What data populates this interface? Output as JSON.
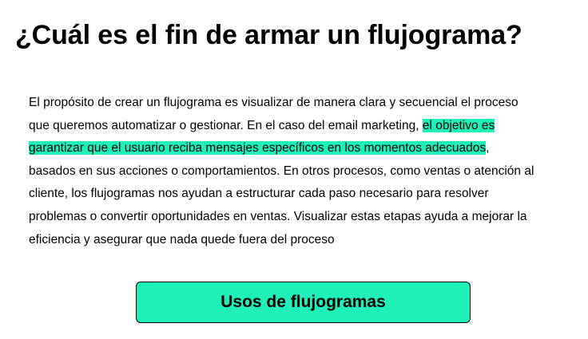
{
  "heading": "¿Cuál es el fin de armar un flujograma?",
  "paragraph": {
    "line1": "El propósito de crear un flujograma es visualizar de manera clara y secuencial el proceso",
    "line2_plain": "que queremos automatizar o gestionar. En el caso del email marketing, ",
    "line2_highlight": "el objetivo es",
    "line3_highlight": "garantizar que el usuario reciba mensajes específicos en los momentos adecuados",
    "line3_plain": ",",
    "line4": "basados en sus acciones o comportamientos. En otros procesos, como ventas o atención al",
    "line5": "cliente, los flujogramas nos ayudan a estructurar cada paso necesario para resolver",
    "line6": "problemas o convertir oportunidades en ventas. Visualizar estas etapas ayuda a mejorar la",
    "line7": "eficiencia y asegurar que nada quede fuera del proceso"
  },
  "cta": {
    "label": "Usos de flujogramas"
  },
  "colors": {
    "highlight": "#1ff0b8",
    "button_background": "#1ff0b8",
    "text": "#000000",
    "background": "#ffffff"
  }
}
